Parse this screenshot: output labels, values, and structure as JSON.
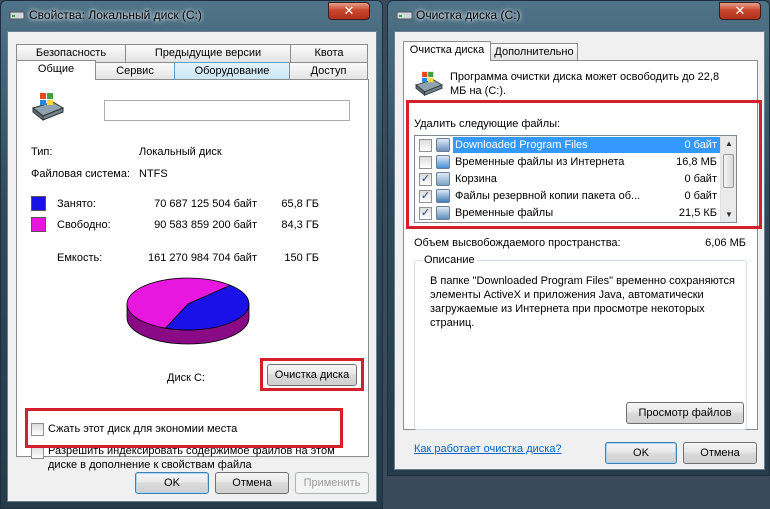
{
  "props": {
    "title": "Свойства: Локальный диск (C:)",
    "close": "✕",
    "tabs_top": [
      "Безопасность",
      "Предыдущие версии",
      "Квота"
    ],
    "tabs_bottom": [
      "Общие",
      "Сервис",
      "Оборудование",
      "Доступ"
    ],
    "name_value": "",
    "type_label": "Тип:",
    "type_value": "Локальный диск",
    "fs_label": "Файловая система:",
    "fs_value": "NTFS",
    "used_label": "Занято:",
    "used_bytes": "70 687 125 504 байт",
    "used_gb": "65,8 ГБ",
    "free_label": "Свободно:",
    "free_bytes": "90 583 859 200 байт",
    "free_gb": "84,3 ГБ",
    "cap_label": "Емкость:",
    "cap_bytes": "161 270 984 704 байт",
    "cap_gb": "150 ГБ",
    "disk_label": "Диск C:",
    "cleanup_btn": "Очистка диска",
    "compress_label": "Сжать этот диск для экономии места",
    "index_label_1": "Разрешить индексировать содержимое файлов на этом",
    "index_label_2": "диске в дополнение к свойствам файла",
    "ok": "OK",
    "cancel": "Отмена",
    "apply": "Применить",
    "used_color": "#1a10e8",
    "free_color": "#e817e0",
    "used_fraction": 0.438
  },
  "cleanup": {
    "title": "Очистка диска  (C:)",
    "close": "✕",
    "tabs": [
      "Очистка диска",
      "Дополнительно"
    ],
    "intro_1": "Программа очистки диска может освободить до 22,8",
    "intro_2": "МБ на  (C:).",
    "files_label": "Удалить следующие файлы:",
    "files": [
      {
        "name": "Downloaded Program Files",
        "size": "0 байт",
        "checked": false,
        "selected": true
      },
      {
        "name": "Временные файлы из Интернета",
        "size": "16,8 МБ",
        "checked": false,
        "selected": false
      },
      {
        "name": "Корзина",
        "size": "0 байт",
        "checked": true,
        "selected": false
      },
      {
        "name": "Файлы резервной копии пакета об...",
        "size": "0 байт",
        "checked": true,
        "selected": false
      },
      {
        "name": "Временные файлы",
        "size": "21,5 КБ",
        "checked": true,
        "selected": false
      }
    ],
    "space_label": "Объем высвобождаемого пространства:",
    "space_value": "6,06 МБ",
    "desc_title": "Описание",
    "desc_lines": [
      "В папке \"Downloaded Program Files\" временно сохраняются",
      "элементы ActiveX и приложения Java, автоматически",
      "загружаемые из Интернета при просмотре некоторых",
      "страниц."
    ],
    "view_files": "Просмотр файлов",
    "how_link": "Как работает очистка диска?",
    "ok": "OK",
    "cancel": "Отмена"
  }
}
